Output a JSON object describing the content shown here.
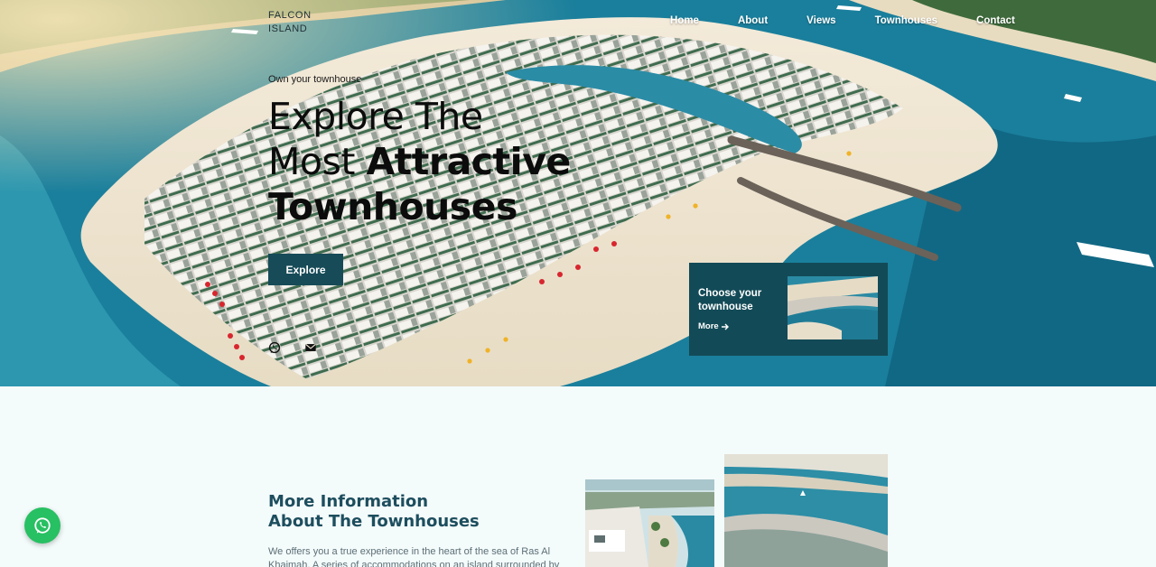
{
  "brand": {
    "line1": "FALCON",
    "line2": "ISLAND"
  },
  "nav": {
    "items": [
      "Home",
      "About",
      "Views",
      "Townhouses",
      "Contact"
    ]
  },
  "hero": {
    "eyebrow": "Own your townhouse",
    "headline": {
      "line1": "Explore The",
      "line2_light": "Most ",
      "line2_bold": "Attractive",
      "line3": "Townhouses"
    },
    "cta_label": "Explore",
    "social_icons": [
      "whatsapp-icon",
      "mail-icon"
    ]
  },
  "card": {
    "title": "Choose your townhouse",
    "link_label": "More",
    "link_icon": "arrow-right-icon"
  },
  "info": {
    "title_line1": "More Information",
    "title_line2": "About The Townhouses",
    "text": "We offers you a true experience in the heart of the sea of Ras Al Khaimah. A series of accommodations on an island surrounded by"
  },
  "floating": {
    "icon": "whatsapp-icon"
  },
  "colors": {
    "accent": "#174b58",
    "card": "#134a57",
    "sea": "#12718f",
    "sand": "#efe5d3",
    "whatsapp": "#27c062",
    "page_bg": "#f4fbfb"
  }
}
